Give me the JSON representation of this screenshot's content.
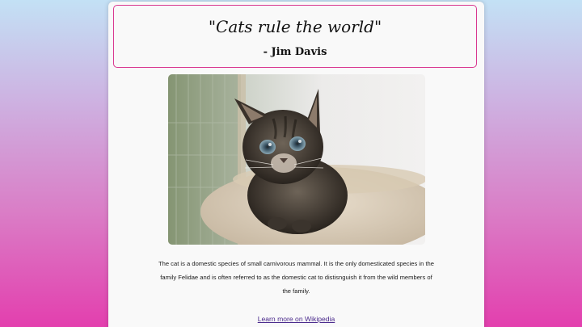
{
  "quote": {
    "text": "\"Cats rule the world\"",
    "author": "- Jim Davis"
  },
  "image": {
    "subject": "kitten-photo"
  },
  "description": "The cat is a domestic species of small carnivorous mammal. It is the only domesticated species in the family Felidae and is often referred to as the domestic cat to distisnguish it from the wild members of the family.",
  "link": {
    "label": "Learn more on Wikipedia"
  },
  "colors": {
    "accent_border": "#d9388f",
    "link": "#4a2a8c",
    "background_top": "#c3e1f5",
    "background_bottom": "#e33fae"
  }
}
